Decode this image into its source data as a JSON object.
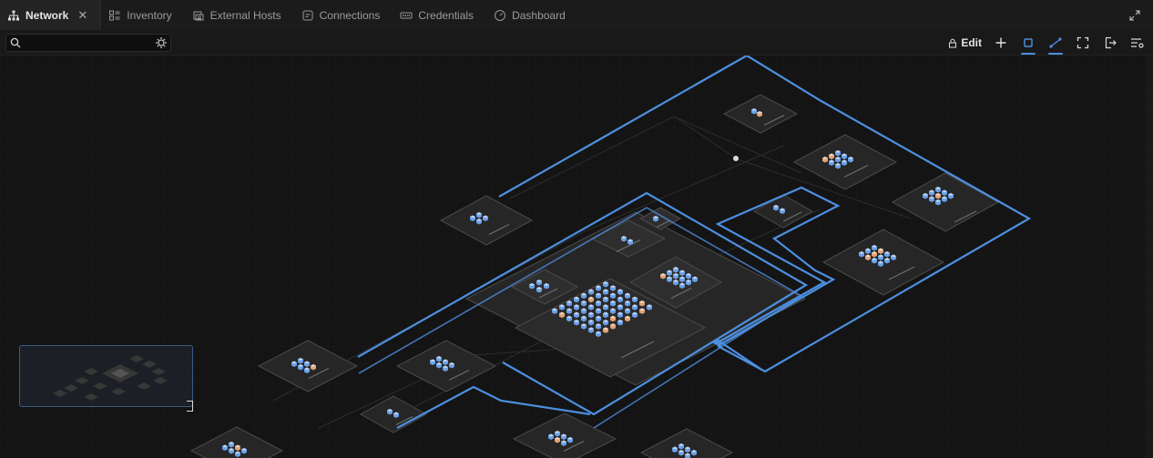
{
  "tabs": [
    {
      "label": "Network",
      "icon": "network-icon",
      "active": true
    },
    {
      "label": "Inventory",
      "icon": "inventory-icon",
      "active": false
    },
    {
      "label": "External Hosts",
      "icon": "external-hosts-icon",
      "active": false
    },
    {
      "label": "Connections",
      "icon": "connections-icon",
      "active": false
    },
    {
      "label": "Credentials",
      "icon": "credentials-icon",
      "active": false
    },
    {
      "label": "Dashboard",
      "icon": "dashboard-icon",
      "active": false
    }
  ],
  "toolbar": {
    "search_placeholder": "",
    "edit_label": "Edit"
  },
  "colors": {
    "accent": "#4d8fe0",
    "background": "#141414",
    "zone_fill": "#2a2a2a",
    "zone_stroke": "#4a4a4a",
    "node_blue": "#6aa0e8",
    "node_orange": "#e0a27a"
  }
}
